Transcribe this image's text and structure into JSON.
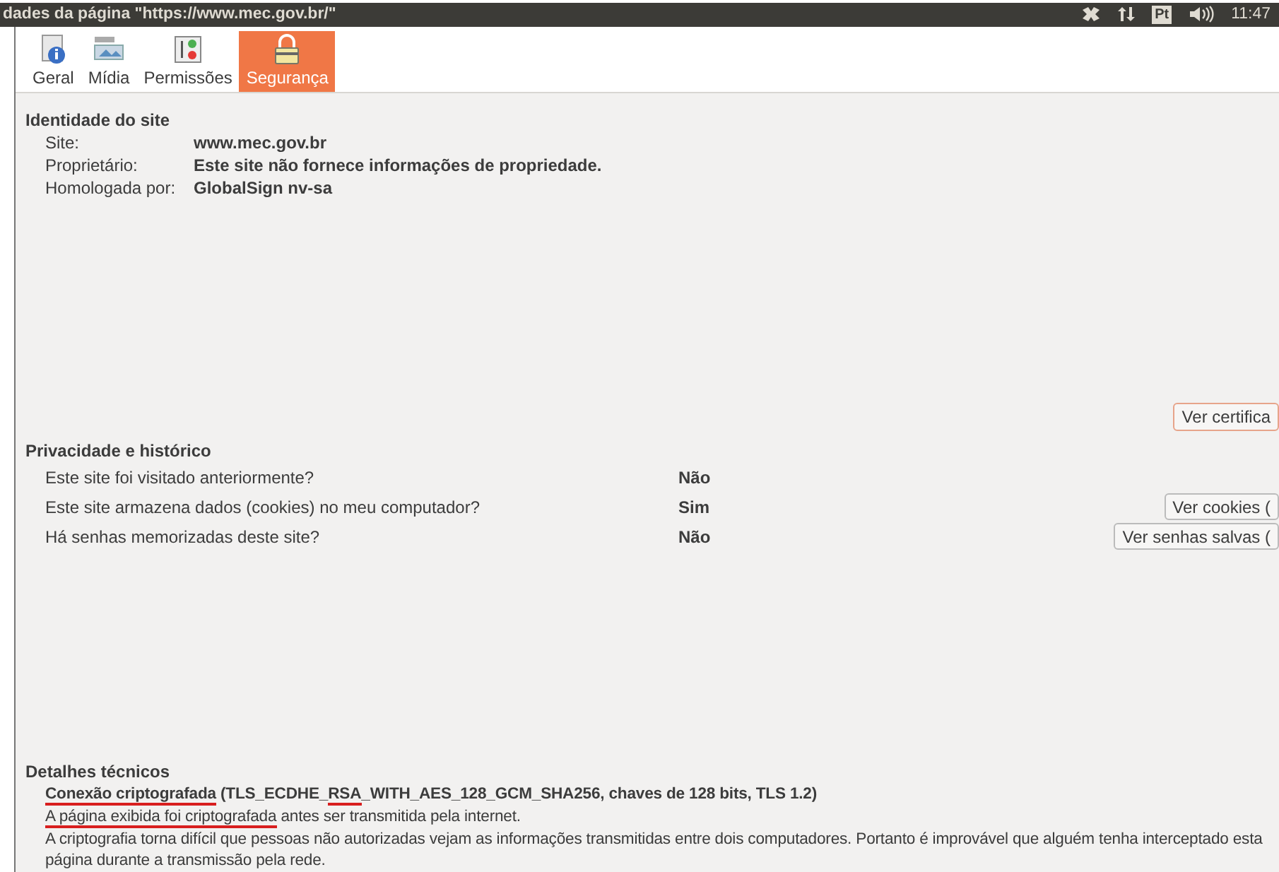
{
  "window": {
    "title": "dades da página \"https://www.mec.gov.br/\""
  },
  "panel_indicators": {
    "keyboard_layout": "Pt",
    "clock": "11:47"
  },
  "tabs": [
    {
      "label": "Geral",
      "kind": "info",
      "selected": false
    },
    {
      "label": "Mídia",
      "kind": "media",
      "selected": false
    },
    {
      "label": "Permissões",
      "kind": "permissions",
      "selected": false
    },
    {
      "label": "Segurança",
      "kind": "lock",
      "selected": true
    }
  ],
  "identity": {
    "heading": "Identidade do site",
    "rows": [
      {
        "label": "Site:",
        "value": "www.mec.gov.br"
      },
      {
        "label": "Proprietário:",
        "value": "Este site não fornece informações de propriedade."
      },
      {
        "label": "Homologada por:",
        "value": "GlobalSign nv-sa"
      }
    ],
    "button": "Ver certifica"
  },
  "privacy": {
    "heading": "Privacidade e histórico",
    "rows": [
      {
        "question": "Este site foi visitado anteriormente?",
        "answer": "Não"
      },
      {
        "question": "Este site armazena dados (cookies) no meu computador?",
        "answer": "Sim",
        "button": "Ver cookies ("
      },
      {
        "question": "Há senhas memorizadas deste site?",
        "answer": "Não",
        "button": "Ver senhas salvas ("
      }
    ]
  },
  "technical": {
    "heading": "Detalhes técnicos",
    "lines": [
      {
        "bold": true,
        "segments": [
          {
            "text": "Conexão criptografada",
            "underlined": true
          },
          {
            "text": " (TLS_ECDHE_",
            "underlined": false
          },
          {
            "text": "RSA",
            "underlined": true
          },
          {
            "text": "_WITH_AES_128_GCM_SHA256, chaves de 128 bits, TLS 1.2)",
            "underlined": false
          }
        ]
      },
      {
        "bold": false,
        "segments": [
          {
            "text": "A página exibida foi criptografada",
            "underlined": true
          },
          {
            "text": " antes ser transmitida pela internet.",
            "underlined": false
          }
        ]
      },
      {
        "bold": false,
        "segments": [
          {
            "text": "A criptografia torna difícil que pessoas não autorizadas vejam as informações transmitidas entre dois computadores. Portanto é improvável que alguém tenha interceptado esta página durante a transmissão pela rede.",
            "underlined": false
          }
        ]
      }
    ]
  }
}
